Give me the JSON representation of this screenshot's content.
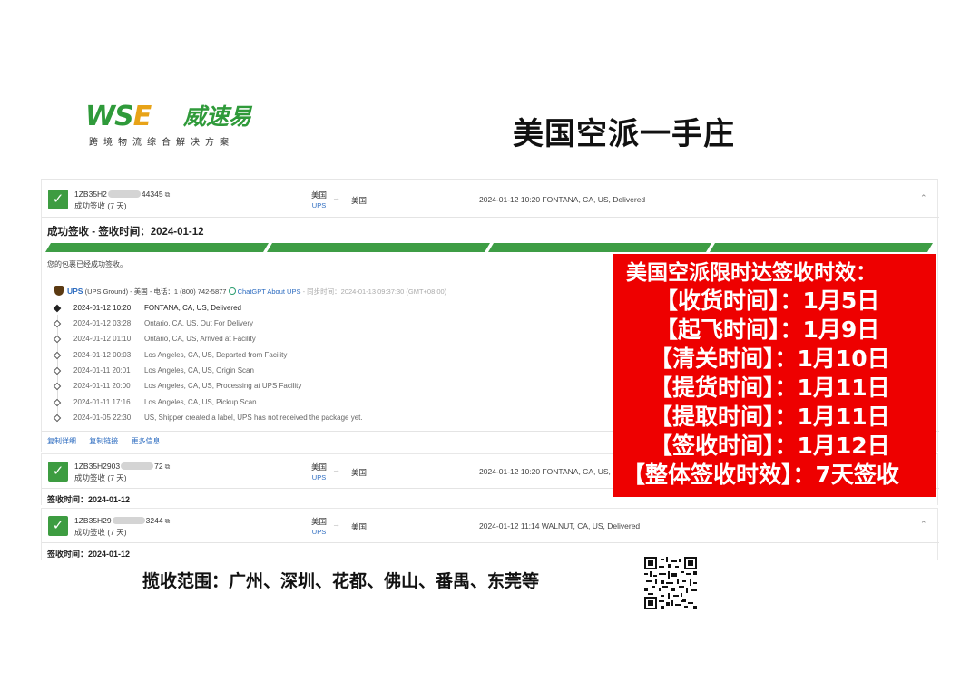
{
  "header": {
    "logo_mark": {
      "w": "W",
      "s": "S",
      "e": "E"
    },
    "logo_cn": "威速易",
    "logo_tagline": "跨境物流综合解决方案",
    "title": "美国空派一手庄"
  },
  "shipments": [
    {
      "tracking_prefix": "1ZB35H2",
      "tracking_suffix": "44345",
      "status": "成功签收 (7 天)",
      "origin": "美国",
      "carrier": "UPS",
      "dest": "美国",
      "latest": "2024-01-12 10:20  FONTANA, CA, US, Delivered",
      "toggle": "⌃",
      "detail_heading": "成功签收 - 签收时间：2024-01-12",
      "delivered_note": "您的包裹已经成功签收。",
      "ups_info": {
        "carrier_name": "UPS",
        "service": "(UPS Ground) - 美国 - 电话：1 (800) 742-5877",
        "chatgpt": "ChatGPT About UPS",
        "sync_time": "- 同步时间：2024-01-13 09:37:30 (GMT+08:00)"
      },
      "events": [
        {
          "time": "2024-01-12 10:20",
          "desc": "FONTANA, CA, US, Delivered"
        },
        {
          "time": "2024-01-12 03:28",
          "desc": "Ontario, CA, US, Out For Delivery"
        },
        {
          "time": "2024-01-12 01:10",
          "desc": "Ontario, CA, US, Arrived at Facility"
        },
        {
          "time": "2024-01-12 00:03",
          "desc": "Los Angeles, CA, US, Departed from Facility"
        },
        {
          "time": "2024-01-11 20:01",
          "desc": "Los Angeles, CA, US, Origin Scan"
        },
        {
          "time": "2024-01-11 20:00",
          "desc": "Los Angeles, CA, US, Processing at UPS Facility"
        },
        {
          "time": "2024-01-11 17:16",
          "desc": "Los Angeles, CA, US, Pickup Scan"
        },
        {
          "time": "2024-01-05 22:30",
          "desc": "US, Shipper created a label, UPS has not received the package yet."
        }
      ],
      "links": [
        "复制详细",
        "复制链接",
        "更多信息"
      ]
    },
    {
      "tracking_prefix": "1ZB35H2903",
      "tracking_suffix": "72",
      "status": "成功签收 (7 天)",
      "origin": "美国",
      "carrier": "UPS",
      "dest": "美国",
      "latest": "2024-01-12 10:20  FONTANA, CA, US, Delivered",
      "signed": "签收时间：2024-01-12"
    },
    {
      "tracking_prefix": "1ZB35H29",
      "tracking_suffix": "3244",
      "status": "成功签收 (7 天)",
      "origin": "美国",
      "carrier": "UPS",
      "dest": "美国",
      "latest": "2024-01-12 11:14  WALNUT, CA, US, Delivered",
      "toggle": "⌃",
      "signed": "签收时间：2024-01-12"
    }
  ],
  "promo": {
    "title": "美国空派限时达签收时效：",
    "lines": [
      "【收货时间】：1月5日",
      "【起飞时间】：1月9日",
      "【清关时间】：1月10日",
      "【提货时间】：1月11日",
      "【提取时间】：1月11日",
      "【签收时间】：1月12日",
      "【整体签收时效】：7天签收"
    ],
    "bg_color": "#ee0000"
  },
  "footer": {
    "scope": "揽收范围：广州、深圳、花都、佛山、番禺、东莞等"
  },
  "colors": {
    "success_green": "#3d9c41",
    "link_blue": "#2d6cc0"
  }
}
